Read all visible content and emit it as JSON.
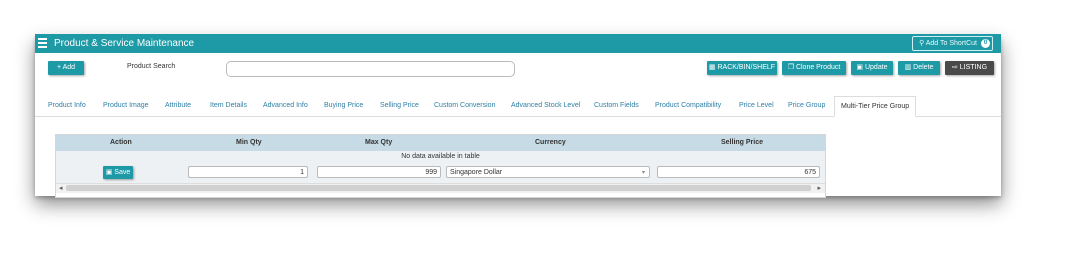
{
  "app": {
    "title": "Product & Service Maintenance",
    "shortcut_label": "Add To ShortCut",
    "shortcut_count": "0"
  },
  "toolbar": {
    "add_label": "+ Add",
    "search_label": "Product Search",
    "search_value": "",
    "rack_label": "RACK/BIN/SHELF",
    "clone_label": "Clone Product",
    "update_label": "Update",
    "delete_label": "Delete",
    "listing_label": "LISTING"
  },
  "tabs": [
    "Product Info",
    "Product Image",
    "Attribute",
    "Item Details",
    "Advanced Info",
    "Buying Price",
    "Selling Price",
    "Custom Conversion",
    "Advanced Stock Level",
    "Custom Fields",
    "Product Compatibility",
    "Price Level",
    "Price Group",
    "Multi-Tier Price Group"
  ],
  "active_tab": "Multi-Tier Price Group",
  "grid": {
    "headers": {
      "action": "Action",
      "min": "Min Qty",
      "max": "Max Qty",
      "currency": "Currency",
      "price": "Selling Price"
    },
    "empty_text": "No data available in table",
    "save_label": "Save",
    "row": {
      "min_qty": "1",
      "max_qty": "999",
      "currency": "Singapore Dollar",
      "selling_price": "675"
    }
  },
  "icons": [
    "menu-icon",
    "shortcut-icon",
    "grid-icon",
    "clone-icon",
    "save-icon",
    "trash-icon",
    "listing-icon",
    "dropdown-caret-icon"
  ]
}
